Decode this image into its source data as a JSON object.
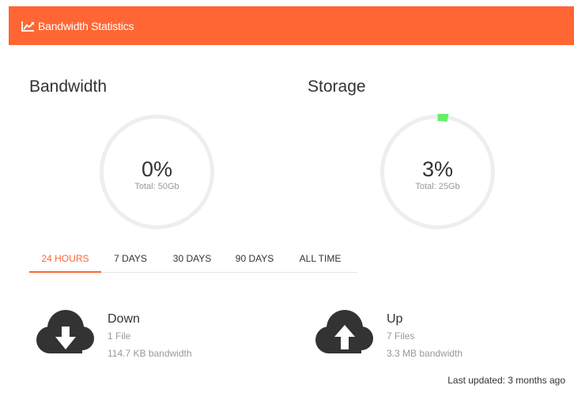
{
  "header": {
    "title": "Bandwidth Statistics",
    "icon": "line-chart-icon",
    "color": "#ff6633"
  },
  "bandwidth": {
    "title": "Bandwidth",
    "percent_label": "0%",
    "percent": 0,
    "total_label": "Total: 50Gb"
  },
  "storage": {
    "title": "Storage",
    "percent_label": "3%",
    "percent": 3,
    "total_label": "Total: 25Gb",
    "accent_color": "#66ee66"
  },
  "tabs": [
    {
      "label": "24 HOURS",
      "active": true
    },
    {
      "label": "7 DAYS",
      "active": false
    },
    {
      "label": "30 DAYS",
      "active": false
    },
    {
      "label": "90 DAYS",
      "active": false
    },
    {
      "label": "ALL TIME",
      "active": false
    }
  ],
  "down": {
    "icon": "cloud-download-icon",
    "label": "Down",
    "files": "1 File",
    "bandwidth": "114.7 KB bandwidth"
  },
  "up": {
    "icon": "cloud-upload-icon",
    "label": "Up",
    "files": "7 Files",
    "bandwidth": "3.3 MB bandwidth"
  },
  "last_updated": "Last updated: 3 months ago"
}
